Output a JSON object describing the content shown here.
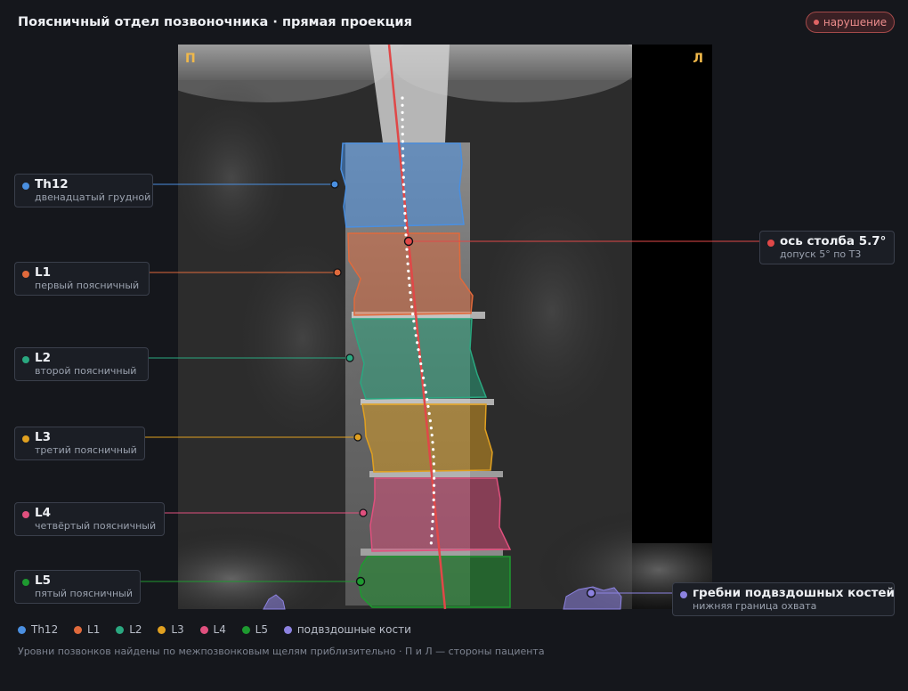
{
  "header": {
    "title": "Поясничный отдел позвоночника · прямая проекция",
    "status_badge": "нарушение"
  },
  "image": {
    "side_left": "П",
    "side_right": "Л"
  },
  "vertebrae": [
    {
      "id": "th12",
      "name": "Th12",
      "desc": "двенадцатый грудной",
      "color": "#4a8fe0"
    },
    {
      "id": "l1",
      "name": "L1",
      "desc": "первый поясничный",
      "color": "#e06a3c"
    },
    {
      "id": "l2",
      "name": "L2",
      "desc": "второй поясничный",
      "color": "#2aa880"
    },
    {
      "id": "l3",
      "name": "L3",
      "desc": "третий поясничный",
      "color": "#e0a020"
    },
    {
      "id": "l4",
      "name": "L4",
      "desc": "четвёртый поясничный",
      "color": "#e0507e"
    },
    {
      "id": "l5",
      "name": "L5",
      "desc": "пятый поясничный",
      "color": "#1e9a30"
    }
  ],
  "axis": {
    "label": "ось столба 5.7°",
    "desc": "допуск 5° по Т3",
    "color": "#e04848",
    "angle_deg": 5.7,
    "tolerance_deg": 5
  },
  "iliac": {
    "label": "гребни подвздошных костей",
    "desc": "нижняя граница охвата",
    "color": "#8c82e0"
  },
  "legend": [
    {
      "label": "Th12",
      "color": "#4a8fe0"
    },
    {
      "label": "L1",
      "color": "#e06a3c"
    },
    {
      "label": "L2",
      "color": "#2aa880"
    },
    {
      "label": "L3",
      "color": "#e0a020"
    },
    {
      "label": "L4",
      "color": "#e0507e"
    },
    {
      "label": "L5",
      "color": "#1e9a30"
    },
    {
      "label": "подвздошные кости",
      "color": "#8c82e0"
    }
  ],
  "footer_note": "Уровни позвонков найдены по межпозвонковым щелям приблизительно · П и Л — стороны пациента"
}
